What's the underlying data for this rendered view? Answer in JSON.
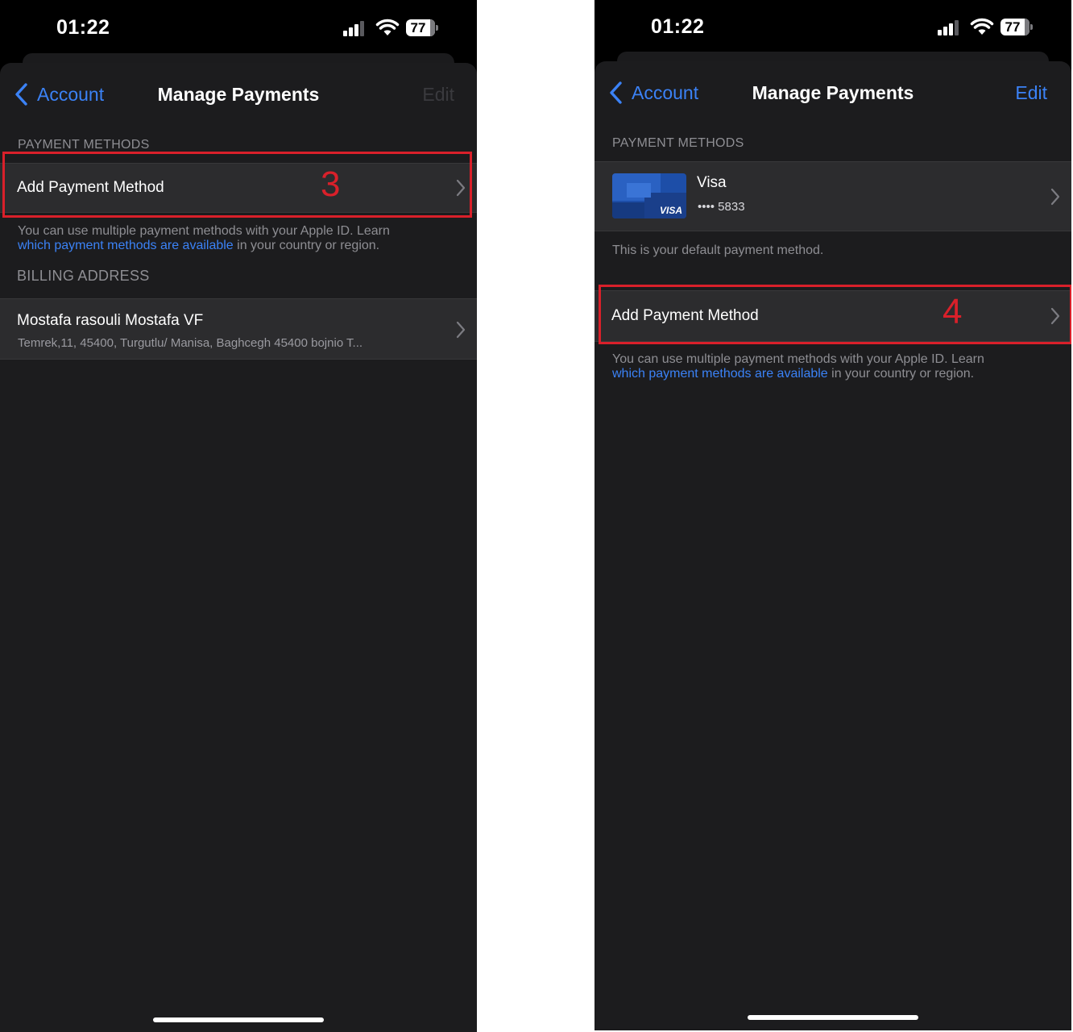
{
  "status_bar": {
    "time": "01:22",
    "battery": "77",
    "battery_level": 0.77
  },
  "colors": {
    "accent": "#3b82f6",
    "annotation": "#d9202a",
    "background": "#1c1c1e",
    "cell": "#2c2c2e"
  },
  "left_screen": {
    "nav": {
      "back_label": "Account",
      "title": "Manage Payments",
      "edit_label": "Edit",
      "edit_enabled": false
    },
    "payment_methods_header": "PAYMENT METHODS",
    "add_payment_label": "Add Payment Method",
    "step_marker": "3",
    "footer": {
      "text_before": "You can use multiple payment methods with your Apple ID. Learn",
      "link_text": "which payment methods are available",
      "text_after": " in your country or region."
    },
    "billing_header": "BILLING ADDRESS",
    "billing": {
      "name": "Mostafa rasouli Mostafa VF",
      "address": "Temrek,11, 45400, Turgutlu/ Manisa, Baghcegh 45400 bojnio T..."
    }
  },
  "right_screen": {
    "nav": {
      "back_label": "Account",
      "title": "Manage Payments",
      "edit_label": "Edit",
      "edit_enabled": true
    },
    "payment_methods_header": "PAYMENT METHODS",
    "card": {
      "brand": "Visa",
      "card_logo_text": "VISA",
      "number": "•••• 5833"
    },
    "default_note": "This is your default payment method.",
    "add_payment_label": "Add Payment Method",
    "step_marker": "4",
    "footer": {
      "text_before": "You can use multiple payment methods with your Apple ID. Learn",
      "link_text": "which payment methods are available",
      "text_after": " in your country or region."
    }
  }
}
